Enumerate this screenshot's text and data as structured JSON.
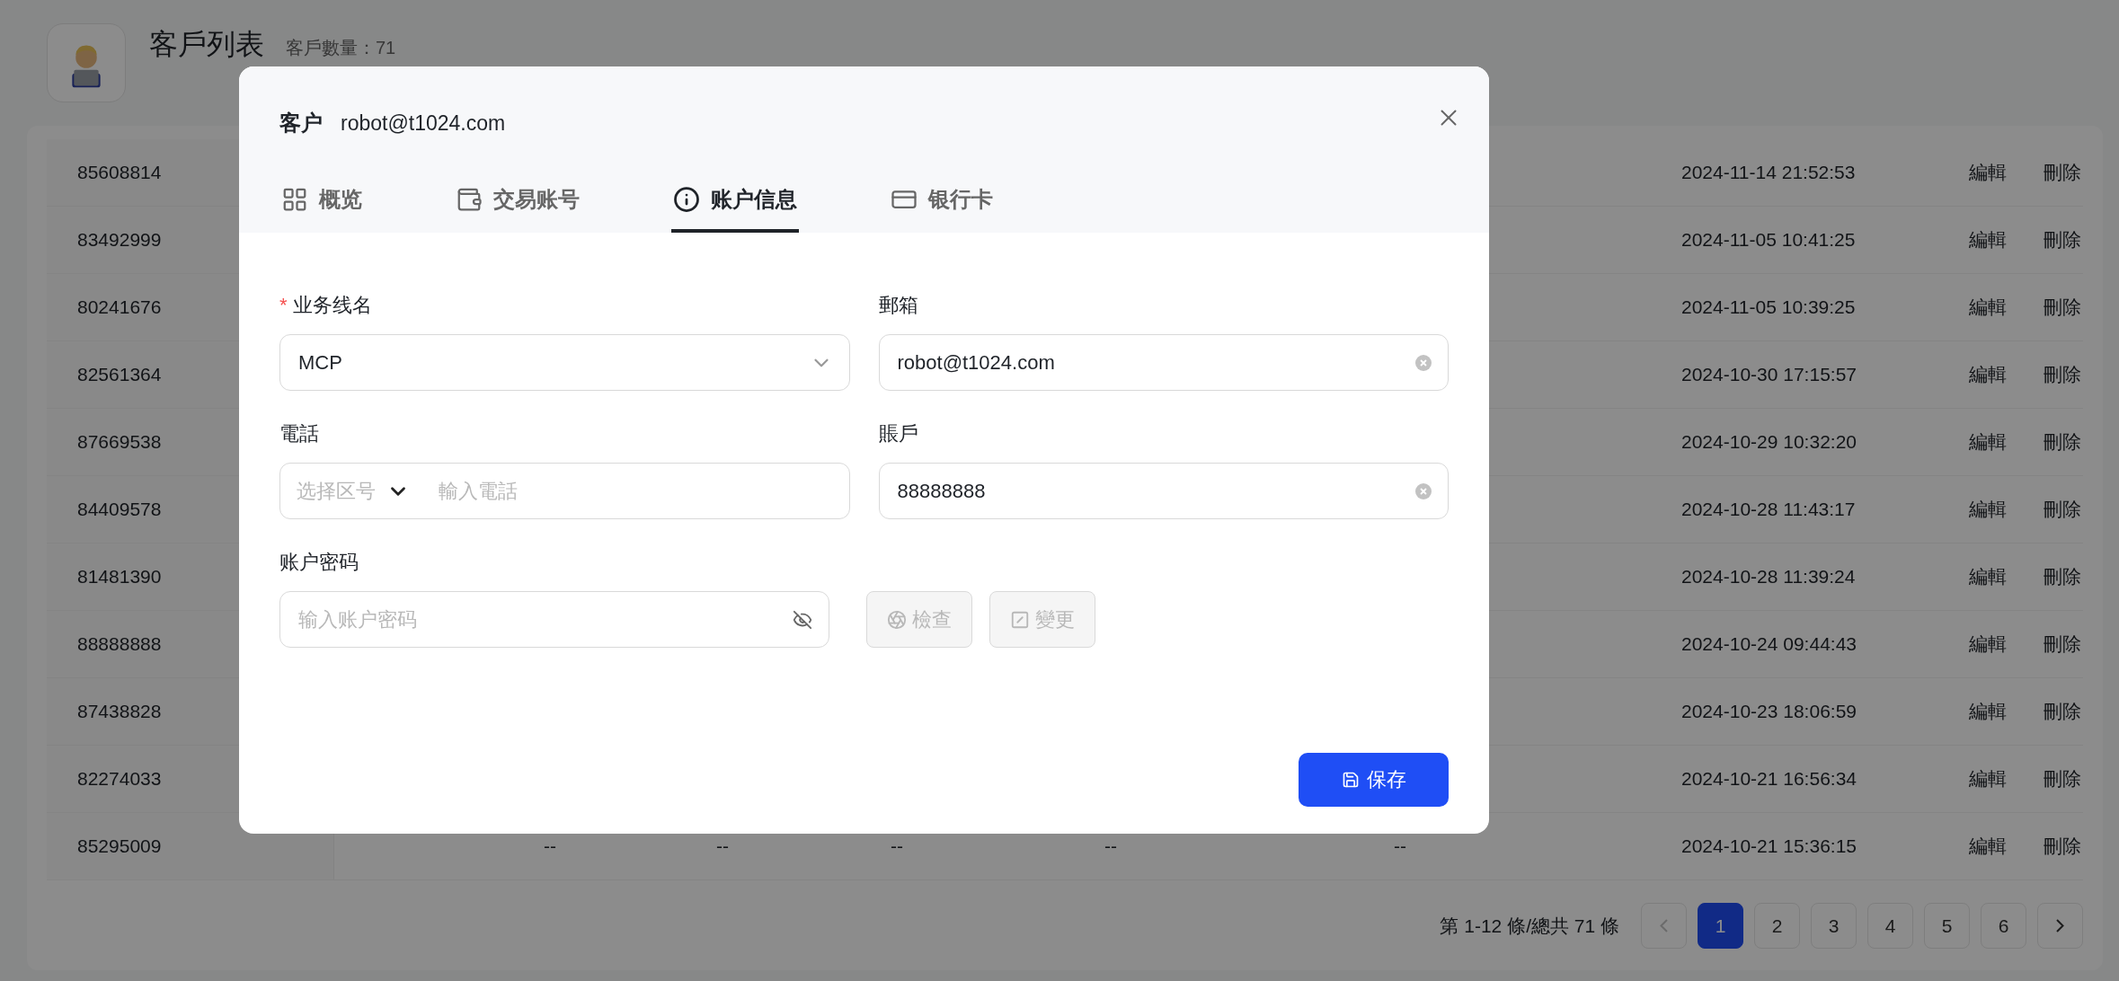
{
  "page": {
    "title": "客戶列表",
    "count": "客戶數量：71"
  },
  "table": {
    "rows": [
      {
        "id": "85608814",
        "date": "2024-11-14 21:52:53",
        "edit": "編輯",
        "delete": "刪除"
      },
      {
        "id": "83492999",
        "date": "2024-11-05 10:41:25",
        "edit": "編輯",
        "delete": "刪除"
      },
      {
        "id": "80241676",
        "date": "2024-11-05 10:39:25",
        "edit": "編輯",
        "delete": "刪除"
      },
      {
        "id": "82561364",
        "date": "2024-10-30 17:15:57",
        "edit": "編輯",
        "delete": "刪除"
      },
      {
        "id": "87669538",
        "date": "2024-10-29 10:32:20",
        "edit": "編輯",
        "delete": "刪除"
      },
      {
        "id": "84409578",
        "date": "2024-10-28 11:43:17",
        "edit": "編輯",
        "delete": "刪除"
      },
      {
        "id": "81481390",
        "date": "2024-10-28 11:39:24",
        "edit": "編輯",
        "delete": "刪除"
      },
      {
        "id": "88888888",
        "date": "2024-10-24 09:44:43",
        "edit": "編輯",
        "delete": "刪除"
      },
      {
        "id": "87438828",
        "date": "2024-10-23 18:06:59",
        "edit": "編輯",
        "delete": "刪除"
      },
      {
        "id": "82274033",
        "date": "2024-10-21 16:56:34",
        "edit": "編輯",
        "delete": "刪除"
      },
      {
        "id": "85295009",
        "cells": [
          "--",
          "--",
          "--",
          "--",
          "--"
        ],
        "date": "2024-10-21 15:36:15",
        "edit": "編輯",
        "delete": "刪除"
      }
    ]
  },
  "pagination": {
    "summary": "第 1-12 條/總共 71 條",
    "prev_disabled": true,
    "next_disabled": false,
    "pages": [
      {
        "label": "1",
        "selected": true
      },
      {
        "label": "2",
        "selected": false
      },
      {
        "label": "3",
        "selected": false
      },
      {
        "label": "4",
        "selected": false
      },
      {
        "label": "5",
        "selected": false
      },
      {
        "label": "6",
        "selected": false
      }
    ]
  },
  "dialog": {
    "title": "客户",
    "subtitle": "robot@t1024.com",
    "tabs": [
      {
        "label": "概览",
        "selected": false
      },
      {
        "label": "交易账号",
        "selected": false
      },
      {
        "label": "账户信息",
        "selected": true
      },
      {
        "label": "银行卡",
        "selected": false
      }
    ],
    "required_mark": "*",
    "fields": [
      {
        "kind": "select",
        "label": "业务线名",
        "required": true,
        "value": "MCP"
      },
      {
        "kind": "text",
        "label": "郵箱",
        "required": false,
        "value": "robot@t1024.com"
      },
      {
        "kind": "phone",
        "label": "電話",
        "required": false,
        "code_placeholder": "选择区号",
        "placeholder": "輸入電話"
      },
      {
        "kind": "text",
        "label": "賬戶",
        "required": false,
        "value": "88888888"
      },
      {
        "kind": "password",
        "label": "账户密码",
        "required": false,
        "placeholder": "输入账户密码"
      }
    ],
    "actions": [
      {
        "label": "檢查",
        "disabled": true
      },
      {
        "label": "變更",
        "disabled": true
      }
    ],
    "save": "保存"
  }
}
